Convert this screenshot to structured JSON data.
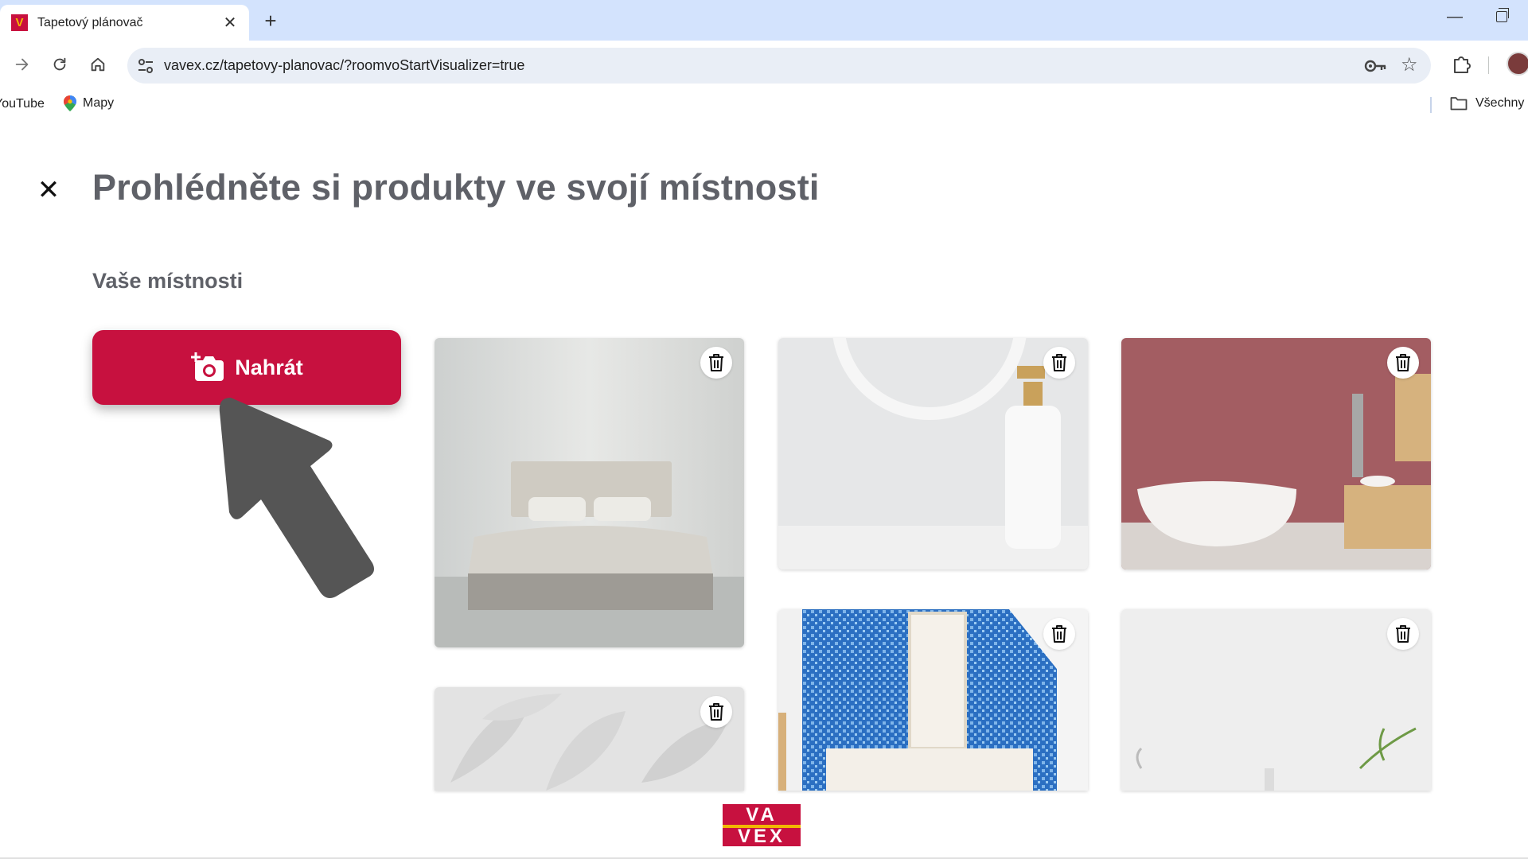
{
  "browser": {
    "tab_title": "Tapetový plánovač",
    "tab_close": "✕",
    "new_tab": "+",
    "url": "vavex.cz/tapetovy-planovac/?roomvoStartVisualizer=true",
    "bookmarks": [
      {
        "label": "YouTube"
      },
      {
        "label": "Mapy"
      }
    ],
    "all_bookmarks_label": "Všechny z"
  },
  "page": {
    "close_symbol": "✕",
    "title": "Prohlédněte si produkty ve svojí místnosti",
    "section_title": "Vaše místnosti",
    "upload_label": "Nahrát"
  },
  "rooms": [
    {
      "name": "bedroom"
    },
    {
      "name": "white-bottle"
    },
    {
      "name": "red-bathroom"
    },
    {
      "name": "leaf-wallpaper"
    },
    {
      "name": "blue-mosaic-bathroom"
    },
    {
      "name": "white-wall"
    }
  ],
  "logo": {
    "line1": "VA",
    "line2": "VEX"
  },
  "colors": {
    "brand": "#c7113f",
    "accent": "#f2b700",
    "title_grey": "#5f6168",
    "chrome_blue": "#d3e3fd"
  }
}
